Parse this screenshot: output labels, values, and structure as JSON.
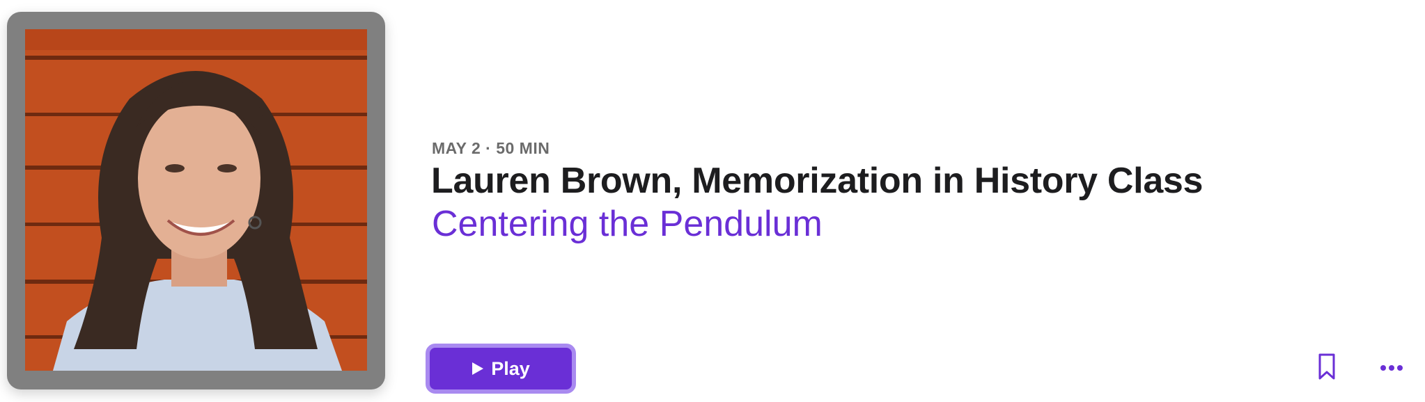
{
  "episode": {
    "meta": "MAY 2 · 50 MIN",
    "title": "Lauren Brown, Memorization in History Class",
    "show": "Centering the Pendulum",
    "artwork_icon": "episode-artwork-portrait"
  },
  "actions": {
    "play_label": "Play",
    "play_icon": "play-icon",
    "bookmark_icon": "bookmark-icon",
    "more_icon": "more-icon"
  },
  "colors": {
    "accent": "#6a2fd6",
    "accent_ring": "#a98af0",
    "title": "#1d1d1f",
    "meta": "#6b6b6b",
    "artwork_frame": "#808080"
  }
}
